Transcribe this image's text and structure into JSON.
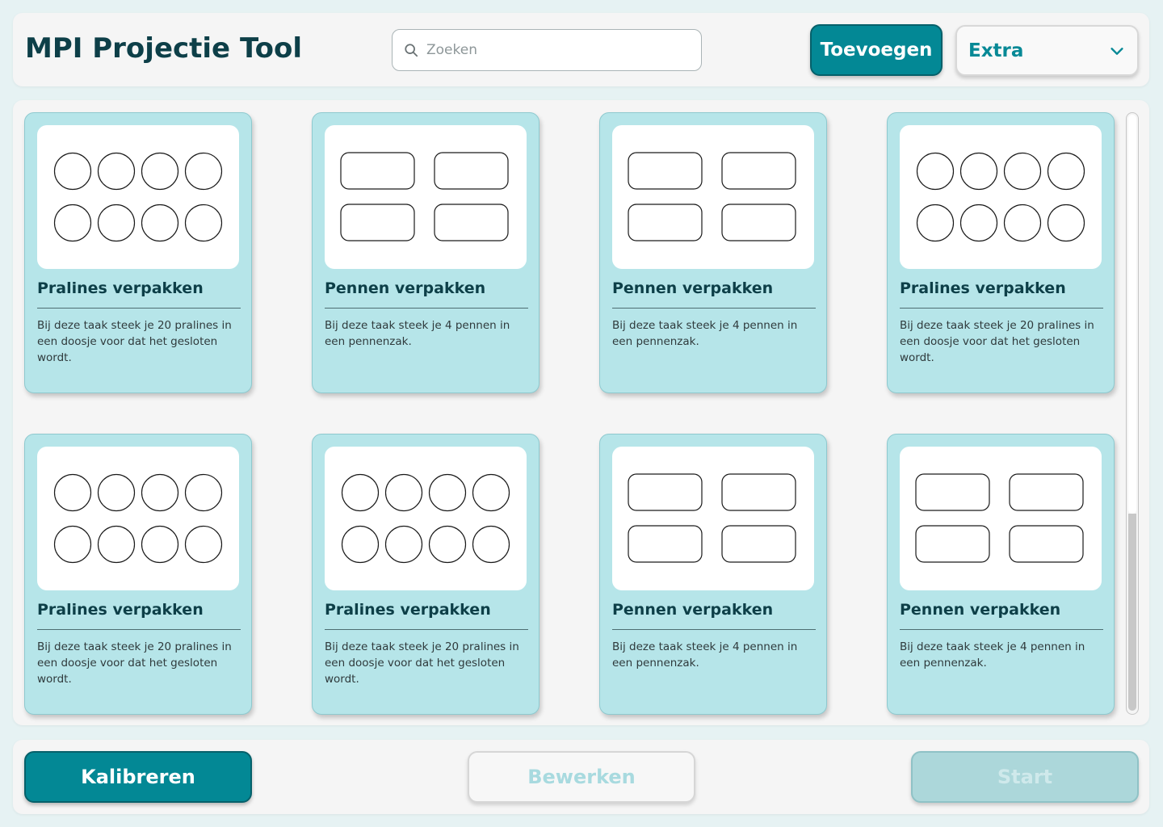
{
  "header": {
    "title": "MPI Projectie Tool",
    "search": {
      "placeholder": "Zoeken",
      "value": "",
      "icon": "search-icon"
    },
    "add_label": "Toevoegen",
    "extra_dropdown": {
      "selected": "Extra",
      "icon": "chevron-down-icon"
    }
  },
  "colors": {
    "accent": "#038895",
    "card_bg": "#b6e5e9",
    "title_text": "#0d3f48",
    "page_bg": "#e6f2f3"
  },
  "tasks": [
    {
      "title": "Pralines verpakken",
      "description": "Bij deze taak steek je 20 pralines in een doosje voor dat het gesloten wordt.",
      "preview": "circles-2x4"
    },
    {
      "title": "Pennen verpakken",
      "description": "Bij deze taak steek je 4 pennen in een pennenzak.",
      "preview": "rects-2x2"
    },
    {
      "title": "Pennen verpakken",
      "description": "Bij deze taak steek je 4 pennen in een pennenzak.",
      "preview": "rects-2x2"
    },
    {
      "title": "Pralines verpakken",
      "description": "Bij deze taak steek je 20 pralines in een doosje voor dat het gesloten wordt.",
      "preview": "circles-2x4"
    },
    {
      "title": "Pralines verpakken",
      "description": "Bij deze taak steek je 20 pralines in een doosje voor dat het gesloten wordt.",
      "preview": "circles-2x4"
    },
    {
      "title": "Pralines verpakken",
      "description": "Bij deze taak steek je 20 pralines in een doosje voor dat het gesloten wordt.",
      "preview": "circles-2x4"
    },
    {
      "title": "Pennen verpakken",
      "description": "Bij deze taak steek je 4 pennen in een pennenzak.",
      "preview": "rects-2x2"
    },
    {
      "title": "Pennen verpakken",
      "description": "Bij deze taak steek je 4 pennen in een pennenzak.",
      "preview": "rects-2x2"
    }
  ],
  "footer": {
    "calibrate_label": "Kalibreren",
    "edit_label": "Bewerken",
    "start_label": "Start"
  }
}
